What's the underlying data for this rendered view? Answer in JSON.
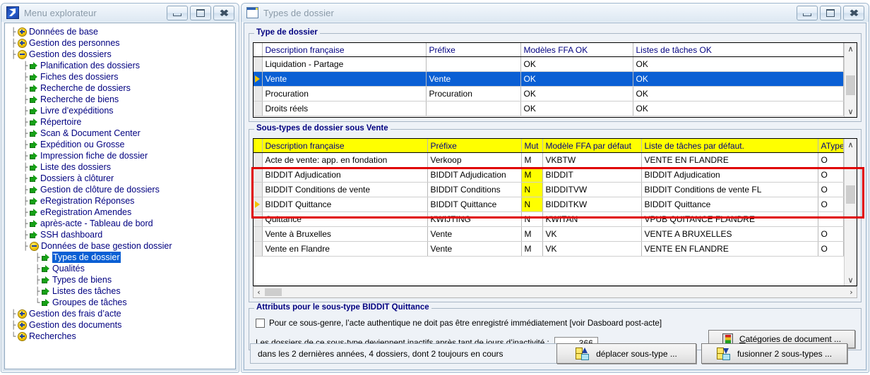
{
  "explorer": {
    "title": "Menu explorateur",
    "icon": "app-icon",
    "buttons": {
      "minimize": "–",
      "maximize": "□",
      "close": "✕"
    },
    "tree": [
      {
        "label": "Données de base",
        "kind": "plus",
        "indent": 1
      },
      {
        "label": "Gestion des personnes",
        "kind": "plus",
        "indent": 1
      },
      {
        "label": "Gestion des dossiers",
        "kind": "minus",
        "indent": 1
      },
      {
        "label": "Planification des dossiers",
        "kind": "arrow",
        "indent": 2
      },
      {
        "label": "Fiches des dossiers",
        "kind": "arrow",
        "indent": 2
      },
      {
        "label": "Recherche de dossiers",
        "kind": "arrow",
        "indent": 2
      },
      {
        "label": "Recherche de biens",
        "kind": "arrow",
        "indent": 2
      },
      {
        "label": "Livre d’expéditions",
        "kind": "arrow",
        "indent": 2
      },
      {
        "label": "Répertoire",
        "kind": "arrow",
        "indent": 2
      },
      {
        "label": "Scan & Document Center",
        "kind": "arrow",
        "indent": 2
      },
      {
        "label": "Expédition ou Grosse",
        "kind": "arrow",
        "indent": 2
      },
      {
        "label": "Impression fiche de dossier",
        "kind": "arrow",
        "indent": 2
      },
      {
        "label": "Liste des dossiers",
        "kind": "arrow",
        "indent": 2
      },
      {
        "label": "Dossiers à clôturer",
        "kind": "arrow",
        "indent": 2
      },
      {
        "label": "Gestion de clôture de dossiers",
        "kind": "arrow",
        "indent": 2
      },
      {
        "label": "eRegistration Réponses",
        "kind": "arrow",
        "indent": 2
      },
      {
        "label": "eRegistration Amendes",
        "kind": "arrow",
        "indent": 2
      },
      {
        "label": "après-acte - Tableau de bord",
        "kind": "arrow",
        "indent": 2
      },
      {
        "label": "SSH dashboard",
        "kind": "arrow",
        "indent": 2
      },
      {
        "label": "Données de base gestion dossier",
        "kind": "minus",
        "indent": 2
      },
      {
        "label": "Types de dossier",
        "kind": "arrow",
        "indent": 3,
        "selected": true
      },
      {
        "label": "Qualités",
        "kind": "arrow",
        "indent": 3
      },
      {
        "label": "Types de biens",
        "kind": "arrow",
        "indent": 3
      },
      {
        "label": "Listes des tâches",
        "kind": "arrow",
        "indent": 3
      },
      {
        "label": "Groupes de tâches",
        "kind": "arrow",
        "indent": 3
      },
      {
        "label": "Gestion des frais d’acte",
        "kind": "plus",
        "indent": 1
      },
      {
        "label": "Gestion des documents",
        "kind": "plus",
        "indent": 1
      },
      {
        "label": "Recherches",
        "kind": "plus",
        "indent": 1
      }
    ]
  },
  "typesWindow": {
    "title": "Types de dossier",
    "icon": "window-icon",
    "buttons": {
      "minimize": "–",
      "maximize": "□",
      "close": "✕"
    },
    "typeGroup": {
      "legend": "Type de dossier",
      "columns": [
        "Description française",
        "Préfixe",
        "Modèles FFA OK",
        "Listes de tâches OK"
      ],
      "rows": [
        {
          "cells": [
            "Liquidation - Partage",
            "",
            "OK",
            "OK"
          ],
          "selected": false,
          "current": false
        },
        {
          "cells": [
            "Vente",
            "Vente",
            "OK",
            "OK"
          ],
          "selected": true,
          "current": true
        },
        {
          "cells": [
            "Procuration",
            "Procuration",
            "OK",
            "OK"
          ],
          "selected": false,
          "current": false
        },
        {
          "cells": [
            "Droits réels",
            "",
            "OK",
            "OK"
          ],
          "selected": false,
          "current": false
        }
      ],
      "scroll": {
        "up": "∧",
        "down": "∨"
      }
    },
    "subGroup": {
      "legend": "Sous-types de dossier sous Vente",
      "columns": [
        "Description française",
        "Préfixe",
        "Mut",
        "Modèle FFA par défaut",
        "Liste de tâches par défaut.",
        "AType"
      ],
      "rows": [
        {
          "cells": [
            "Acte de vente: app. en fondation",
            "Verkoop",
            "M",
            "VKBTW",
            "VENTE EN FLANDRE",
            "O"
          ],
          "mutHighlight": false,
          "current": false
        },
        {
          "cells": [
            "BIDDIT Adjudication",
            "BIDDIT Adjudication",
            "M",
            "BIDDIT",
            "BIDDIT Adjudication",
            "O"
          ],
          "mutHighlight": true,
          "current": false
        },
        {
          "cells": [
            "BIDDIT Conditions de vente",
            "BIDDIT Conditions",
            "N",
            "BIDDITVW",
            "BIDDIT Conditions de vente FL",
            "O"
          ],
          "mutHighlight": true,
          "current": false
        },
        {
          "cells": [
            "BIDDIT Quittance",
            "BIDDIT Quittance",
            "N",
            "BIDDITKW",
            "BIDDIT Quittance",
            "O"
          ],
          "mutHighlight": true,
          "current": true
        },
        {
          "cells": [
            "Quittance",
            "KWIJTING",
            "N",
            "KWITAN",
            "VPUB QUITANCE FLANDRE",
            ""
          ],
          "mutHighlight": false,
          "current": false
        },
        {
          "cells": [
            "Vente à Bruxelles",
            "Vente",
            "M",
            "VK",
            "VENTE A BRUXELLES",
            "O"
          ],
          "mutHighlight": false,
          "current": false
        },
        {
          "cells": [
            "Vente en Flandre",
            "Vente",
            "M",
            "VK",
            "VENTE EN FLANDRE",
            "O"
          ],
          "mutHighlight": false,
          "current": false
        }
      ],
      "scroll": {
        "up": "∧",
        "down": "∨",
        "left": "‹",
        "right": "›"
      }
    },
    "attributes": {
      "legend": "Attributs pour le sous-type BIDDIT Quittance",
      "checkbox_label": "Pour ce sous-genre, l’acte authentique ne doit pas être enregistré immédiatement [voir Dasboard post-acte]",
      "checkbox_checked": false,
      "inactivity_label": "Les dossiers de ce sous-type deviennent inactifs après tant de jours d’inactivité :",
      "inactivity_days": "366",
      "categories_button": {
        "accesskey": "C",
        "rest": "atégories de document ..."
      }
    },
    "footer": {
      "status": "dans les 2 dernières années, 4 dossiers, dont 2 toujours en cours",
      "move_button": "déplacer sous-type ...",
      "merge_button": "fusionner 2 sous-types ..."
    }
  },
  "colors": {
    "header_yellow": "#ffff00",
    "selection_blue": "#0a5fd4",
    "label_navy": "#000080",
    "highlight_red": "#e00000"
  }
}
